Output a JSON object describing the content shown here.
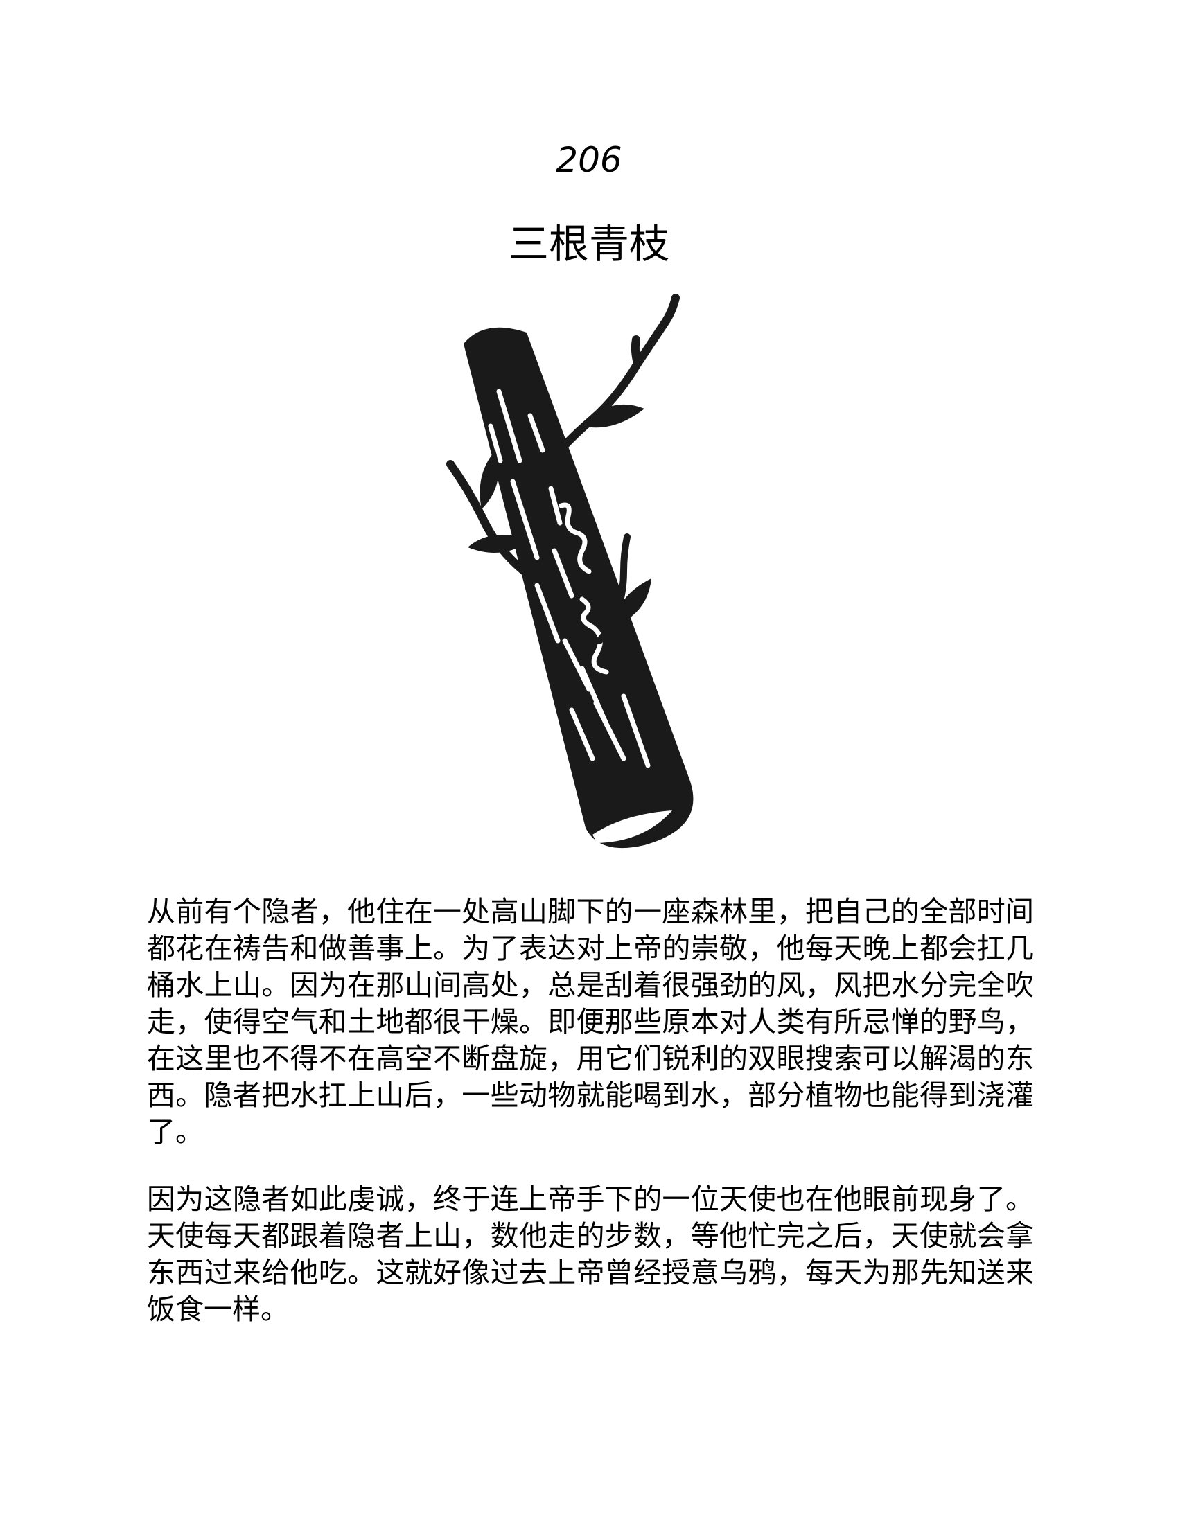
{
  "page": {
    "number": "206",
    "title": "三根青枝"
  },
  "illustration": {
    "icon": "branch-icon",
    "color": "#1a1a1a"
  },
  "story": {
    "paragraphs": [
      "从前有个隐者，他住在一处高山脚下的一座森林里，把自己的全部时间都花在祷告和做善事上。为了表达对上帝的崇敬，他每天晚上都会扛几桶水上山。因为在那山间高处，总是刮着很强劲的风，风把水分完全吹走，使得空气和土地都很干燥。即便那些原本对人类有所忌惮的野鸟，在这里也不得不在高空不断盘旋，用它们锐利的双眼搜索可以解渴的东西。隐者把水扛上山后，一些动物就能喝到水，部分植物也能得到浇灌了。",
      "因为这隐者如此虔诚，终于连上帝手下的一位天使也在他眼前现身了。天使每天都跟着隐者上山，数他走的步数，等他忙完之后，天使就会拿东西过来给他吃。这就好像过去上帝曾经授意乌鸦，每天为那先知送来饭食一样。"
    ]
  }
}
